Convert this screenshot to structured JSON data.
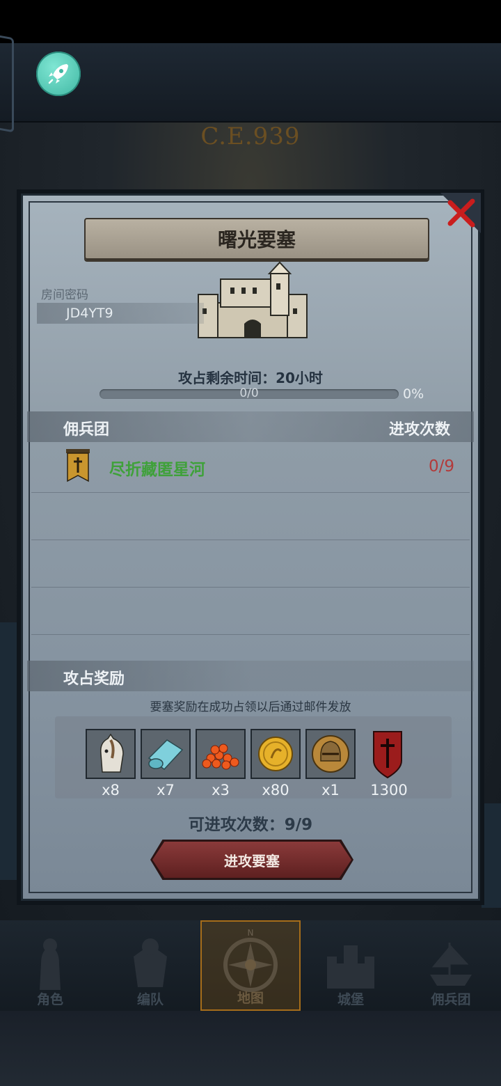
{
  "background": {
    "era_text": "C.E.939"
  },
  "modal": {
    "title": "曙光要塞",
    "room_password_label": "房间密码",
    "room_password": "JD4YT9",
    "timer_label": "攻占剩余时间：20小时",
    "progress": {
      "value_text": "0/0",
      "percent_text": "0%",
      "fraction": 0
    },
    "table": {
      "col_left": "佣兵团",
      "col_right": "进攻次数",
      "rows": [
        {
          "name": "尽折藏匿星河",
          "count": "0/9"
        }
      ]
    },
    "rewards": {
      "header": "攻占奖励",
      "note": "要塞奖励在成功占领以后通过邮件发放",
      "items": [
        {
          "icon": "horse-icon",
          "qty": "x8"
        },
        {
          "icon": "cloth-icon",
          "qty": "x7"
        },
        {
          "icon": "berries-icon",
          "qty": "x3"
        },
        {
          "icon": "gold-coin-icon",
          "qty": "x80"
        },
        {
          "icon": "helmet-icon",
          "qty": "x1"
        },
        {
          "icon": "guild-banner-icon",
          "qty": "1300"
        }
      ]
    },
    "attempts_label": "可进攻次数：9/9",
    "attack_button": "进攻要塞"
  },
  "nav": {
    "items": [
      {
        "label": "角色",
        "icon": "knight-icon"
      },
      {
        "label": "编队",
        "icon": "armor-icon"
      },
      {
        "label": "地图",
        "icon": "compass-icon",
        "active": true
      },
      {
        "label": "城堡",
        "icon": "castle-icon"
      },
      {
        "label": "佣兵团",
        "icon": "ship-icon"
      }
    ]
  },
  "colors": {
    "accent_green": "#3fa13a",
    "accent_red": "#b33a3a",
    "rocket": "#4ec5b1"
  }
}
